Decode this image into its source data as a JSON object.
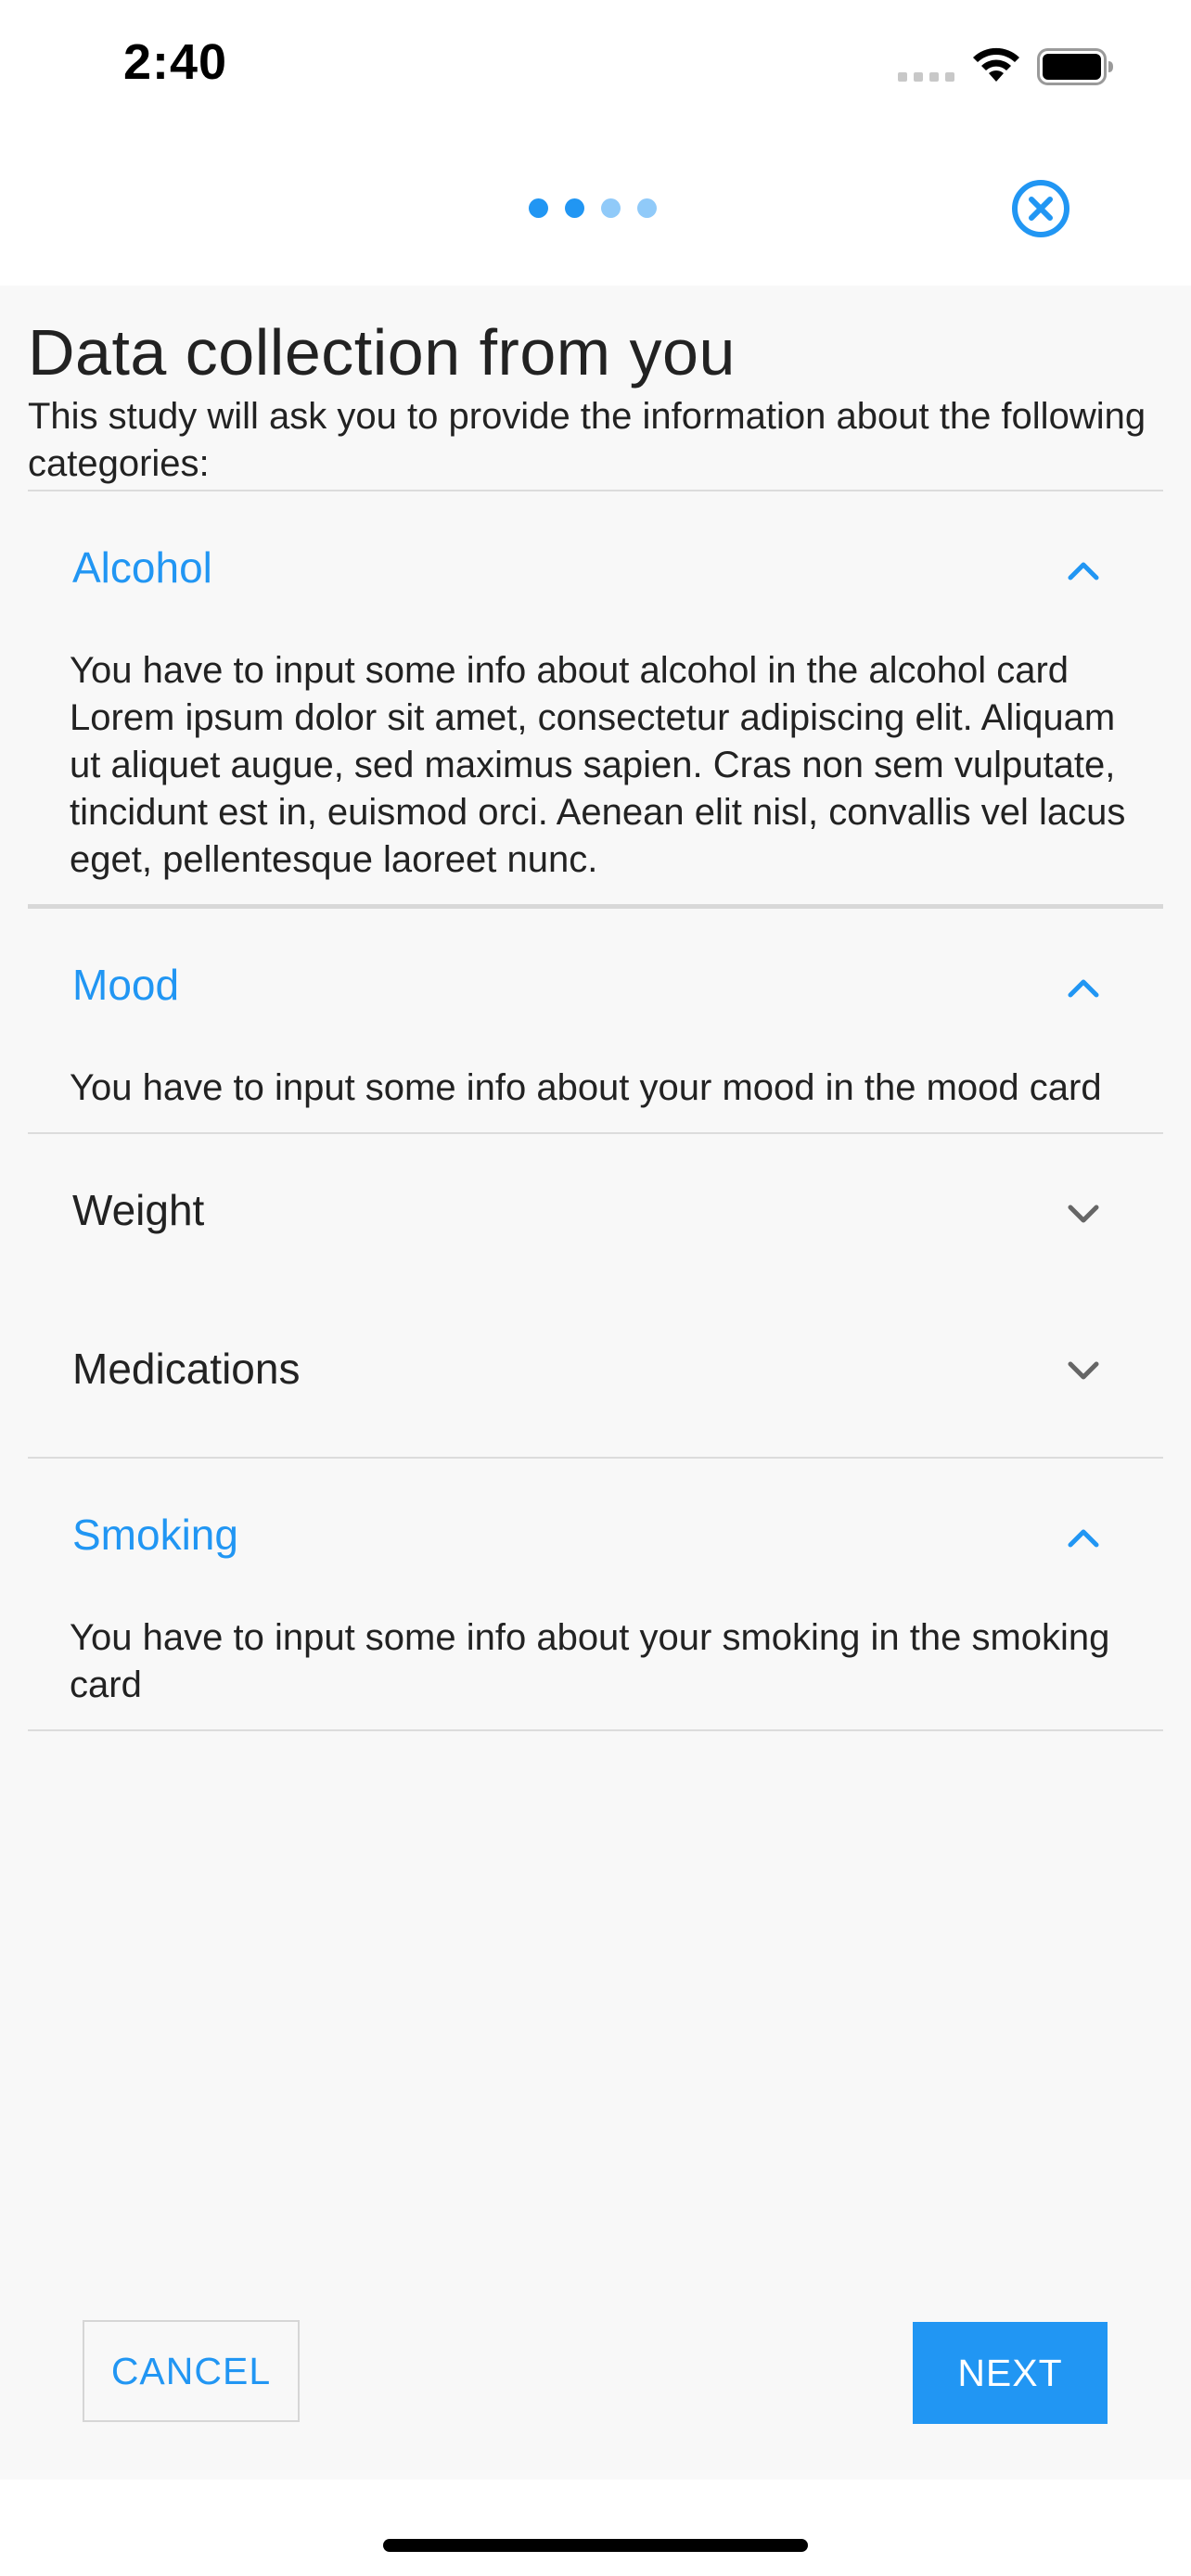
{
  "status_bar": {
    "time": "2:40"
  },
  "nav": {
    "steps": [
      {
        "state": "completed"
      },
      {
        "state": "current"
      },
      {
        "state": "upcoming"
      },
      {
        "state": "upcoming"
      }
    ],
    "close_icon": "close-circle-icon"
  },
  "page": {
    "title": "Data collection from you",
    "intro": "This study will ask you to provide the information about the following categories:"
  },
  "categories": [
    {
      "label": "Alcohol",
      "expanded": true,
      "description": "You have to input some info about alcohol in the alcohol card  Lorem ipsum dolor sit amet, consectetur adipiscing elit. Aliquam ut aliquet augue, sed maximus sapien. Cras non sem vulputate, tincidunt est in, euismod orci. Aenean elit nisl, convallis vel lacus eget, pellentesque laoreet nunc."
    },
    {
      "label": "Mood",
      "expanded": true,
      "description": "You have to input some info about your mood in the mood card"
    },
    {
      "label": "Weight",
      "expanded": false
    },
    {
      "label": "Medications",
      "expanded": false
    },
    {
      "label": "Smoking",
      "expanded": true,
      "description": "You have to input some info about your smoking in the smoking card"
    }
  ],
  "actions": {
    "cancel_label": "CANCEL",
    "next_label": "NEXT"
  },
  "colors": {
    "accent": "#2196f3",
    "accent_light": "#90caf9",
    "background": "#f8f8f8",
    "text": "#222222",
    "chevron_collapsed": "#666666"
  }
}
